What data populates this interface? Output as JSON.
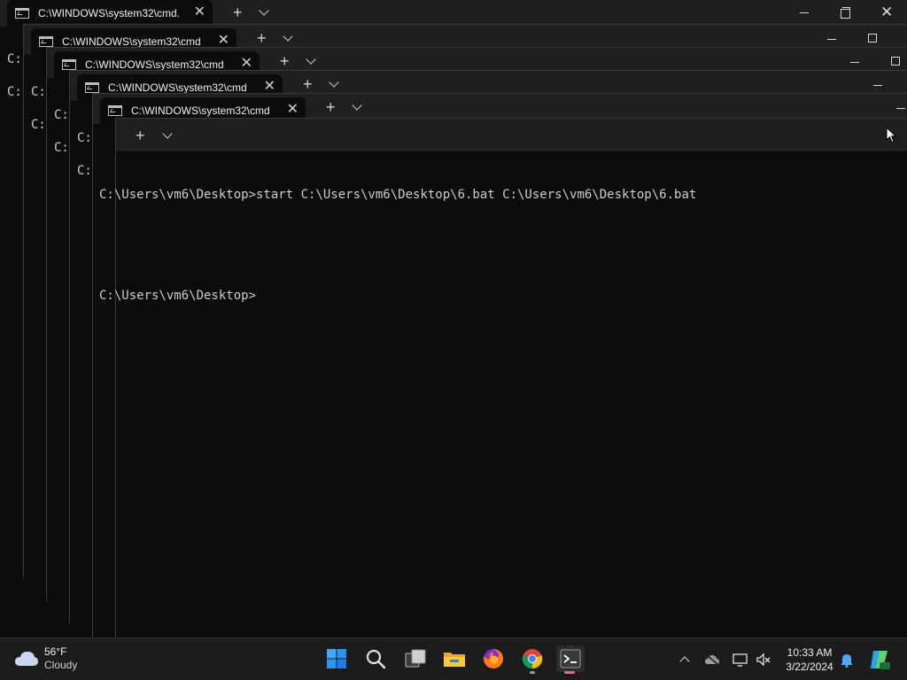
{
  "window_title": "C:\\WINDOWS\\system32\\cmd.",
  "back_window_title": "C:\\WINDOWS\\system32\\cmd",
  "prompt_fragment": "C:",
  "console": {
    "line1": "C:\\Users\\vm6\\Desktop>start C:\\Users\\vm6\\Desktop\\6.bat C:\\Users\\vm6\\Desktop\\6.bat",
    "line2": "C:\\Users\\vm6\\Desktop>"
  },
  "tab_controls": {
    "close": "✕",
    "new_tab": "+"
  },
  "weather": {
    "temp": "56°F",
    "condition": "Cloudy"
  },
  "clock": {
    "time": "10:33 AM",
    "date": "3/22/2024"
  },
  "taskbar_icons": [
    "start-icon",
    "search-icon",
    "task-view-icon",
    "file-explorer-icon",
    "firefox-icon",
    "chrome-icon",
    "terminal-icon"
  ],
  "colors": {
    "accent_active": "#e06c88",
    "console_bg": "#0c0c0c",
    "titlebar_bg": "#1f1f1f"
  }
}
